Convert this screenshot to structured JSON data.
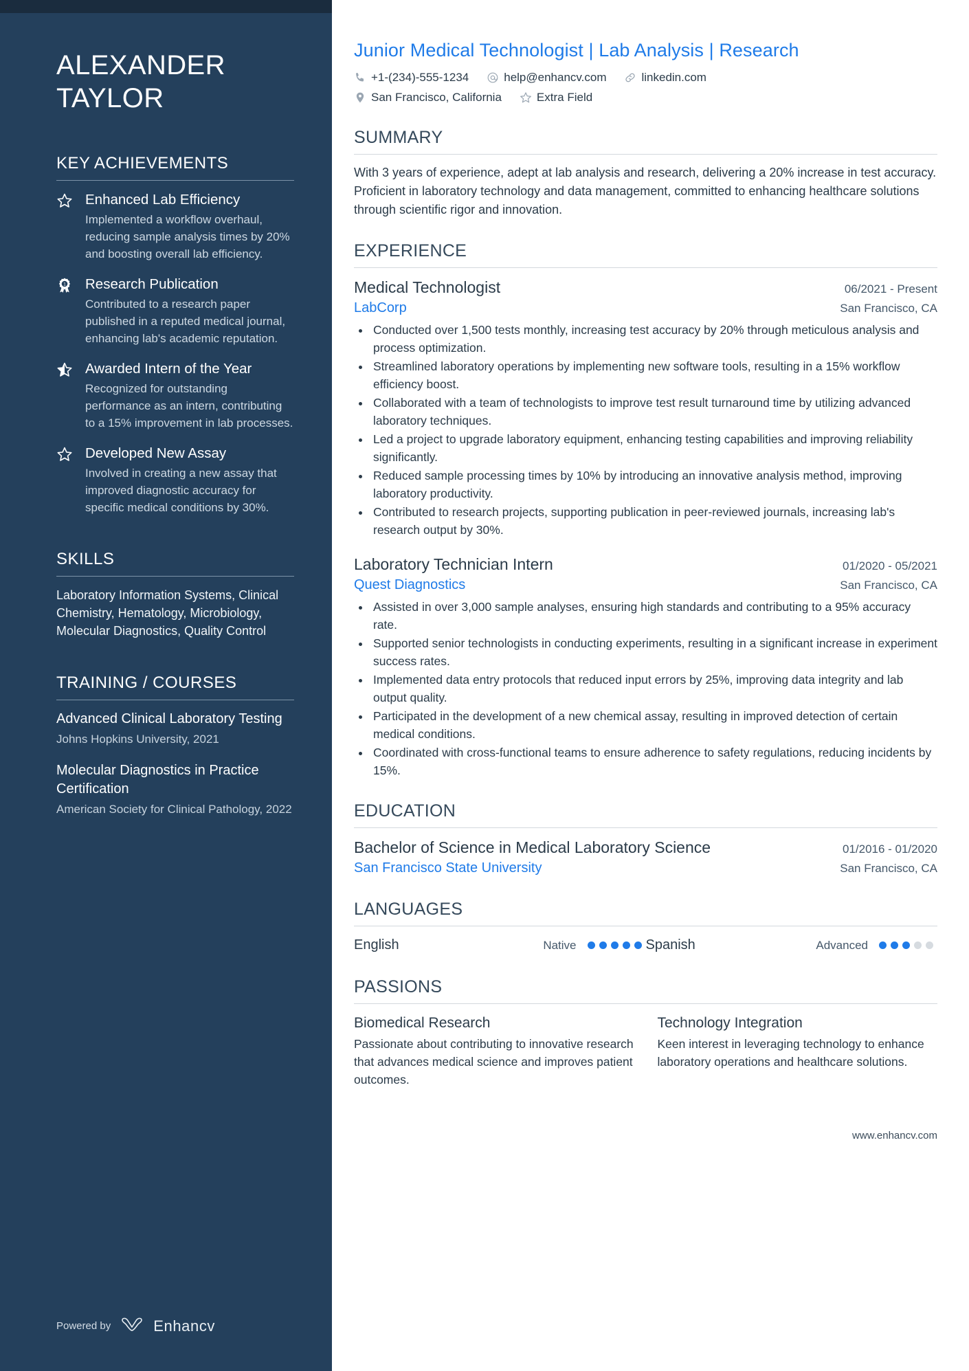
{
  "sidebar": {
    "name_line1": "ALEXANDER",
    "name_line2": "TAYLOR",
    "achievements_heading": "KEY ACHIEVEMENTS",
    "achievements": [
      {
        "icon": "star-outline-icon",
        "title": "Enhanced Lab Efficiency",
        "desc": "Implemented a workflow overhaul, reducing sample analysis times by 20% and boosting overall lab efficiency."
      },
      {
        "icon": "award-ribbon-icon",
        "title": "Research Publication",
        "desc": "Contributed to a research paper published in a reputed medical journal, enhancing lab's academic reputation."
      },
      {
        "icon": "star-half-icon",
        "title": "Awarded Intern of the Year",
        "desc": "Recognized for outstanding performance as an intern, contributing to a 15% improvement in lab processes."
      },
      {
        "icon": "star-outline-icon",
        "title": "Developed New Assay",
        "desc": "Involved in creating a new assay that improved diagnostic accuracy for specific medical conditions by 30%."
      }
    ],
    "skills_heading": "SKILLS",
    "skills_text": "Laboratory Information Systems, Clinical Chemistry, Hematology, Microbiology, Molecular Diagnostics, Quality Control",
    "training_heading": "TRAINING / COURSES",
    "courses": [
      {
        "title": "Advanced Clinical Laboratory Testing",
        "sub": "Johns Hopkins University, 2021"
      },
      {
        "title": "Molecular Diagnostics in Practice Certification",
        "sub": "American Society for Clinical Pathology, 2022"
      }
    ],
    "powered_by_label": "Powered by",
    "brand_name": "Enhancv"
  },
  "header": {
    "job_title": "Junior Medical Technologist | Lab Analysis | Research",
    "contacts_row1": [
      {
        "icon": "phone-icon",
        "text": "+1-(234)-555-1234"
      },
      {
        "icon": "at-email-icon",
        "text": "help@enhancv.com"
      },
      {
        "icon": "link-icon",
        "text": "linkedin.com"
      }
    ],
    "contacts_row2": [
      {
        "icon": "location-pin-icon",
        "text": "San Francisco, California"
      },
      {
        "icon": "star-outline-icon",
        "text": "Extra Field"
      }
    ]
  },
  "summary": {
    "heading": "SUMMARY",
    "text": "With 3 years of experience, adept at lab analysis and research, delivering a 20% increase in test accuracy. Proficient in laboratory technology and data management, committed to enhancing healthcare solutions through scientific rigor and innovation."
  },
  "experience": {
    "heading": "EXPERIENCE",
    "entries": [
      {
        "title": "Medical Technologist",
        "date": "06/2021 - Present",
        "org": "LabCorp",
        "location": "San Francisco, CA",
        "bullets": [
          "Conducted over 1,500 tests monthly, increasing test accuracy by 20% through meticulous analysis and process optimization.",
          "Streamlined laboratory operations by implementing new software tools, resulting in a 15% workflow efficiency boost.",
          "Collaborated with a team of technologists to improve test result turnaround time by utilizing advanced laboratory techniques.",
          "Led a project to upgrade laboratory equipment, enhancing testing capabilities and improving reliability significantly.",
          "Reduced sample processing times by 10% by introducing an innovative analysis method, improving laboratory productivity.",
          "Contributed to research projects, supporting publication in peer-reviewed journals, increasing lab's research output by 30%."
        ]
      },
      {
        "title": "Laboratory Technician Intern",
        "date": "01/2020 - 05/2021",
        "org": "Quest Diagnostics",
        "location": "San Francisco, CA",
        "bullets": [
          "Assisted in over 3,000 sample analyses, ensuring high standards and contributing to a 95% accuracy rate.",
          "Supported senior technologists in conducting experiments, resulting in a significant increase in experiment success rates.",
          "Implemented data entry protocols that reduced input errors by 25%, improving data integrity and lab output quality.",
          "Participated in the development of a new chemical assay, resulting in improved detection of certain medical conditions.",
          "Coordinated with cross-functional teams to ensure adherence to safety regulations, reducing incidents by 15%."
        ]
      }
    ]
  },
  "education": {
    "heading": "EDUCATION",
    "entries": [
      {
        "title": "Bachelor of Science in Medical Laboratory Science",
        "date": "01/2016 - 01/2020",
        "org": "San Francisco State University",
        "location": "San Francisco, CA"
      }
    ]
  },
  "languages": {
    "heading": "LANGUAGES",
    "items": [
      {
        "name": "English",
        "level": "Native",
        "filled": 5,
        "total": 5
      },
      {
        "name": "Spanish",
        "level": "Advanced",
        "filled": 3,
        "total": 5
      }
    ]
  },
  "passions": {
    "heading": "PASSIONS",
    "items": [
      {
        "title": "Biomedical Research",
        "desc": "Passionate about contributing to innovative research that advances medical science and improves patient outcomes."
      },
      {
        "title": "Technology Integration",
        "desc": "Keen interest in leveraging technology to enhance laboratory operations and healthcare solutions."
      }
    ]
  },
  "footer": {
    "website": "www.enhancv.com"
  },
  "colors": {
    "sidebar_bg": "#24405C",
    "sidebar_topband": "#1A2C3E",
    "accent_blue": "#1F7BE8",
    "heading_slate": "#35495B",
    "body_text": "#2b3b49"
  }
}
